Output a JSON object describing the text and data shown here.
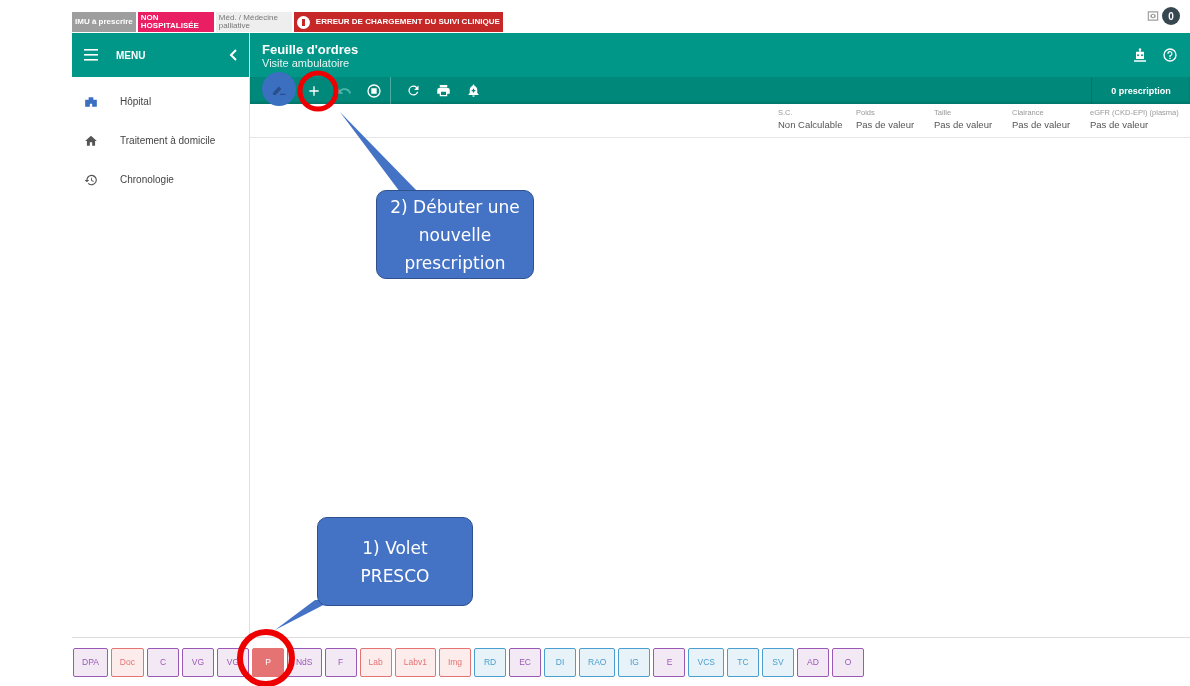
{
  "status_tags": [
    {
      "kind": "grey",
      "text": "IMU à prescrire"
    },
    {
      "kind": "pink",
      "text": "NON HOSPITALISÉE"
    },
    {
      "kind": "plain",
      "text": "Méd. / Médecine palliative"
    },
    {
      "kind": "error",
      "text": "ERREUR DE CHARGEMENT DU SUIVI CLINIQUE"
    }
  ],
  "notification_count": "0",
  "menu": {
    "title": "MENU",
    "items": [
      {
        "kind": "hospital",
        "label": "Hôpital"
      },
      {
        "kind": "home",
        "label": "Traitement à domicile"
      },
      {
        "kind": "history",
        "label": "Chronologie"
      }
    ]
  },
  "header": {
    "title": "Feuille d'ordres",
    "subtitle": "Visite ambulatoire"
  },
  "prescription_count": "0 prescription",
  "vitals": [
    {
      "label": "S.C.",
      "value": "Non Calculable"
    },
    {
      "label": "Poids",
      "value": "Pas de valeur"
    },
    {
      "label": "Taille",
      "value": "Pas de valeur"
    },
    {
      "label": "Clairance",
      "value": "Pas de valeur"
    },
    {
      "label": "eGFR (CKD-EPI) (plasma)",
      "value": "Pas de valeur"
    }
  ],
  "panel_tabs": [
    {
      "label": "DPA",
      "color": "#9b59b6",
      "selected": false
    },
    {
      "label": "Doc",
      "color": "#e57373",
      "selected": false
    },
    {
      "label": "C",
      "color": "#9b59b6",
      "selected": false
    },
    {
      "label": "VG",
      "color": "#9b59b6",
      "selected": false
    },
    {
      "label": "VG",
      "color": "#9b59b6",
      "selected": false
    },
    {
      "label": "P",
      "color": "#e57373",
      "selected": true
    },
    {
      "label": "NdS",
      "color": "#9b59b6",
      "selected": false
    },
    {
      "label": "F",
      "color": "#9b59b6",
      "selected": false
    },
    {
      "label": "Lab",
      "color": "#e57373",
      "selected": false
    },
    {
      "label": "Labv1",
      "color": "#e57373",
      "selected": false
    },
    {
      "label": "Img",
      "color": "#e57373",
      "selected": false
    },
    {
      "label": "RD",
      "color": "#4a9fd0",
      "selected": false
    },
    {
      "label": "EC",
      "color": "#9b59b6",
      "selected": false
    },
    {
      "label": "DI",
      "color": "#4a9fd0",
      "selected": false
    },
    {
      "label": "RAO",
      "color": "#4a9fd0",
      "selected": false
    },
    {
      "label": "IG",
      "color": "#4a9fd0",
      "selected": false
    },
    {
      "label": "E",
      "color": "#9b59b6",
      "selected": false
    },
    {
      "label": "VCS",
      "color": "#4a9fd0",
      "selected": false
    },
    {
      "label": "TC",
      "color": "#4a9fd0",
      "selected": false
    },
    {
      "label": "SV",
      "color": "#4a9fd0",
      "selected": false
    },
    {
      "label": "AD",
      "color": "#9b59b6",
      "selected": false
    },
    {
      "label": "O",
      "color": "#9b59b6",
      "selected": false
    }
  ],
  "annotations": [
    {
      "text": "2) Débuter une nouvelle prescription"
    },
    {
      "text": "1) Volet PRESCO"
    }
  ]
}
